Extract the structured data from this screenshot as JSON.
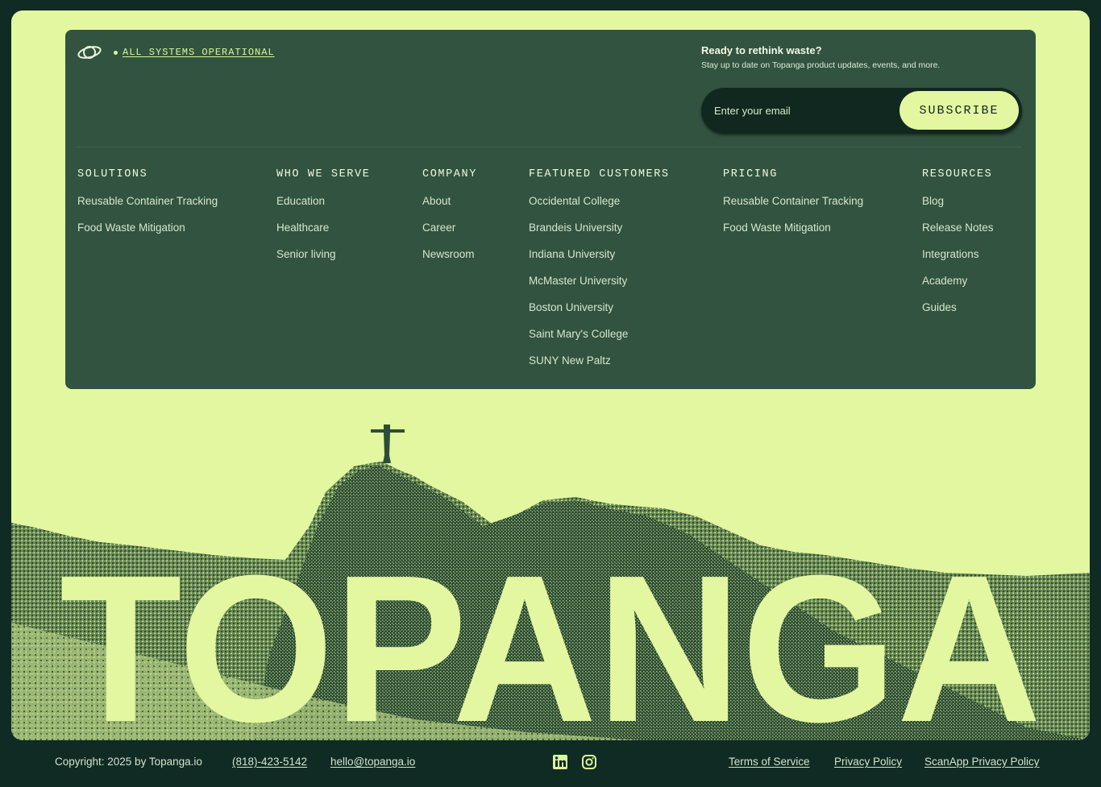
{
  "header": {
    "status_label": "ALL SYSTEMS OPERATIONAL",
    "logo_icon": "topanga-logo-icon"
  },
  "newsletter": {
    "title": "Ready to rethink waste?",
    "subtitle": "Stay up to date on Topanga product updates, events, and more.",
    "placeholder": "Enter your email",
    "button_label": "SUBSCRIBE"
  },
  "columns": [
    {
      "heading": "SOLUTIONS",
      "links": [
        "Reusable Container Tracking",
        "Food Waste Mitigation"
      ]
    },
    {
      "heading": "WHO WE SERVE",
      "links": [
        "Education",
        "Healthcare",
        "Senior living"
      ]
    },
    {
      "heading": "COMPANY",
      "links": [
        "About",
        "Career",
        "Newsroom"
      ]
    },
    {
      "heading": "FEATURED CUSTOMERS",
      "links": [
        "Occidental College",
        "Brandeis University",
        "Indiana University",
        "McMaster University",
        "Boston University",
        "Saint Mary's College",
        "SUNY New Paltz"
      ]
    },
    {
      "heading": "PRICING",
      "links": [
        "Reusable Container Tracking",
        "Food Waste Mitigation"
      ]
    },
    {
      "heading": "RESOURCES",
      "links": [
        "Blog",
        "Release Notes",
        "Integrations",
        "Academy",
        "Guides"
      ]
    }
  ],
  "brand": {
    "wordmark": "TOPANGA"
  },
  "footer": {
    "copyright": "Copyright: 2025 by Topanga.io",
    "phone": "(818)-423-5142",
    "email": "hello@topanga.io",
    "social_icons": [
      "linkedin-icon",
      "instagram-icon"
    ],
    "links": [
      "Terms of Service",
      "Privacy Policy",
      "ScanApp Privacy Policy"
    ]
  },
  "colors": {
    "page_bg": "#0f2b24",
    "frame_bg": "#e2f7a0",
    "panel_bg": "#32533f",
    "accent": "#d9f59a",
    "input_bg": "#10281f"
  }
}
